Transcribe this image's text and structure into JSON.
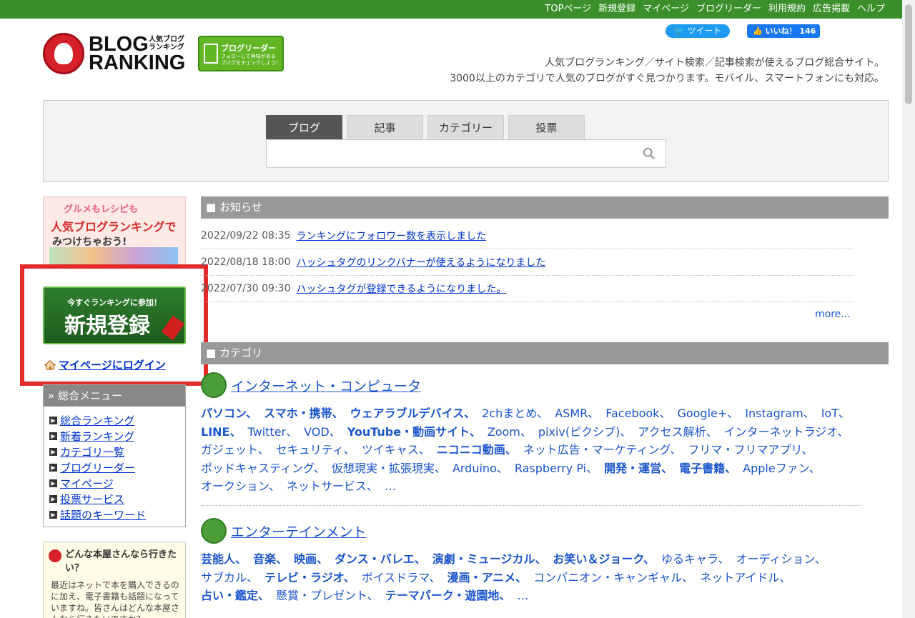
{
  "topnav": [
    "TOPページ",
    "新規登録",
    "マイページ",
    "ブログリーダー",
    "利用規約",
    "広告掲載",
    "ヘルプ"
  ],
  "logo": {
    "line1": "BLOG",
    "line2": "RANKING",
    "sub1": "人気ブログ",
    "sub2": "ランキング"
  },
  "reader_badge": {
    "title": "ブログリーダー",
    "sub1": "フォローして興味がある",
    "sub2": "ブログをチェックしよう!"
  },
  "social": {
    "tweet": "ツイート",
    "like": "いいね！ 146"
  },
  "tagline": [
    "人気ブログランキング／サイト検索／記事検索が使えるブログ総合サイト。",
    "3000以上のカテゴリで人気のブログがすぐ見つかります。モバイル、スマートフォンにも対応。"
  ],
  "search": {
    "tabs": [
      "ブログ",
      "記事",
      "カテゴリー",
      "投票"
    ],
    "placeholder": ""
  },
  "side_banner": {
    "line1": "グルメもレシピも",
    "line2": "人気ブログランキングで",
    "line3": "みつけちゃおう!"
  },
  "register": {
    "small": "今すぐランキングに参加！",
    "big": "新規登録"
  },
  "login_link": "マイページにログイン",
  "menu": {
    "title": "» 総合メニュー",
    "items": [
      "総合ランキング",
      "新着ランキング",
      "カテゴリ一覧",
      "ブログリーダー",
      "マイページ",
      "投票サービス",
      "話題のキーワード"
    ]
  },
  "bookbox": {
    "title": "どんな本屋さんなら行きたい？",
    "body": "最近はネットで本を購入できるのに加え、電子書籍も話題になっていますね。皆さんはどんな本屋さんなら行きたいですか？"
  },
  "news": {
    "title": "■ お知らせ",
    "items": [
      {
        "date": "2022/09/22 08:35",
        "text": "ランキングにフォロワー数を表示しました"
      },
      {
        "date": "2022/08/18 18:00",
        "text": "ハッシュタグのリンクバナーが使えるようになりました"
      },
      {
        "date": "2022/07/30 09:30",
        "text": "ハッシュタグが登録できるようになりました。"
      }
    ],
    "more": "more..."
  },
  "categories": {
    "title": "■ カテゴリ",
    "groups": [
      {
        "name": "インターネット・コンピュータ",
        "lines": [
          [
            "パソコン、",
            "スマホ・携帯、",
            "ウェアラブルデバイス、",
            "2chまとめ、",
            "ASMR、",
            "Facebook、",
            "Google+、",
            "Instagram、",
            "IoT、"
          ],
          [
            "LINE、",
            "Twitter、",
            "VOD、",
            "YouTube・動画サイト、",
            "Zoom、",
            "pixiv(ピクシブ)、",
            "アクセス解析、",
            "インターネットラジオ、"
          ],
          [
            "ガジェット、",
            "セキュリティ、",
            "ツイキャス、",
            "ニコニコ動画、",
            "ネット広告・マーケティング、",
            "フリマ・フリマアプリ、"
          ],
          [
            "ポッドキャスティング、",
            "仮想現実・拡張現実、",
            "Arduino、",
            "Raspberry Pi、",
            "開発・運営、",
            "電子書籍、",
            "Appleファン、"
          ],
          [
            "オークション、",
            "ネットサービス、",
            "…"
          ]
        ]
      },
      {
        "name": "エンターテインメント",
        "lines": [
          [
            "芸能人、",
            "音楽、",
            "映画、",
            "ダンス・バレエ、",
            "演劇・ミュージカル、",
            "お笑い＆ジョーク、",
            "ゆるキャラ、",
            "オーディション、"
          ],
          [
            "サブカル、",
            "テレビ・ラジオ、",
            "ボイスドラマ、",
            "漫画・アニメ、",
            "コンパニオン・キャンギャル、",
            "ネットアイドル、"
          ],
          [
            "占い・鑑定、",
            "懸賞・プレゼント、",
            "テーマパーク・遊園地、",
            "…"
          ]
        ]
      }
    ]
  },
  "bold_terms": [
    "パソコン、",
    "スマホ・携帯、",
    "ウェアラブルデバイス、",
    "LINE、",
    "YouTube・動画サイト、",
    "ニコニコ動画、",
    "開発・運営、",
    "電子書籍、",
    "芸能人、",
    "音楽、",
    "映画、",
    "ダンス・バレエ、",
    "演劇・ミュージカル、",
    "お笑い＆ジョーク、",
    "テレビ・ラジオ、",
    "漫画・アニメ、",
    "占い・鑑定、",
    "テーマパーク・遊園地、"
  ]
}
